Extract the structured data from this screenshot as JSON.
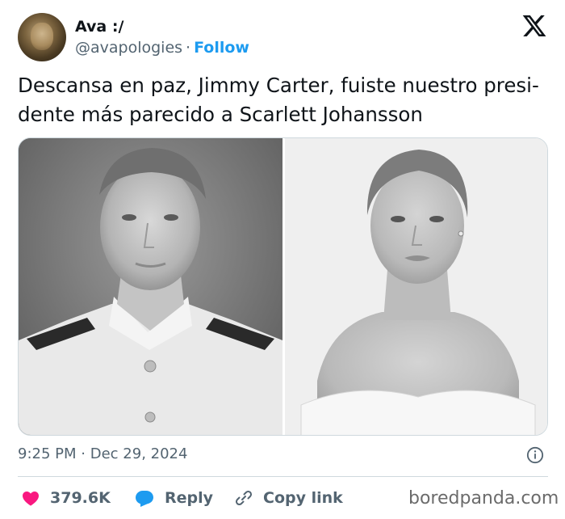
{
  "author": {
    "name": "Ava :/",
    "handle": "@avapologies",
    "separator": "·",
    "follow_label": "Follow"
  },
  "tweet": {
    "text_line1": "Descansa en paz, Jimmy Carter, fuiste nuestro presi-",
    "text_line2": "dente más parecido a Scarlett Johansson"
  },
  "media": {
    "images": [
      {
        "subject": "black-and-white portrait of a young man in a white naval uniform"
      },
      {
        "subject": "black-and-white portrait of a woman in an off-shoulder white top"
      }
    ]
  },
  "meta": {
    "time": "9:25 PM",
    "separator": "·",
    "date": "Dec 29, 2024"
  },
  "actions": {
    "likes_count": "379.6K",
    "reply_label": "Reply",
    "copy_link_label": "Copy link"
  },
  "watermark": "boredpanda.com",
  "colors": {
    "accent": "#1d9bf0",
    "like": "#f91880",
    "text_primary": "#0f1419",
    "text_secondary": "#536471",
    "border": "#cfd9de"
  },
  "icons": [
    "x-logo-icon",
    "info-icon",
    "heart-icon",
    "reply-bubble-icon",
    "link-icon"
  ]
}
